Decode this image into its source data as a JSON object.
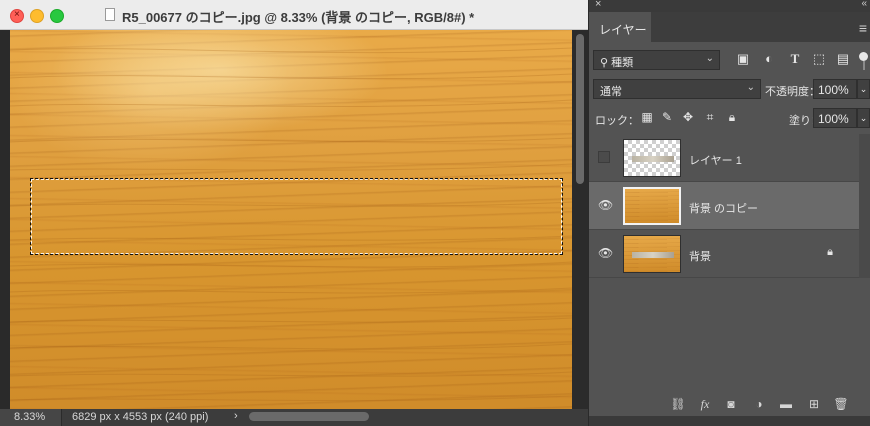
{
  "window": {
    "title": "R5_00677 のコピー.jpg @ 8.33% (背景 のコピー, RGB/8#) *"
  },
  "status_bar": {
    "zoom": "8.33%",
    "doc_size": "6829 px x 4553 px (240 ppi)",
    "arrow": "›"
  },
  "layers_panel": {
    "close_glyph": "×",
    "collapse_glyph": "«",
    "tab_label": "レイヤー",
    "menu_glyph": "≡",
    "filter_kind": "種類",
    "filter_icons": [
      "image-filter-icon",
      "adjustment-filter-icon",
      "type-filter-icon",
      "shape-filter-icon",
      "smart-object-filter-icon"
    ],
    "blend_mode": "通常",
    "opacity_label": "不透明度：",
    "opacity_value": "100%",
    "lock_label": "ロック：",
    "fill_label": "塗り：",
    "fill_value": "100%",
    "layers": [
      {
        "name": "レイヤー 1",
        "visible": false,
        "selected": false,
        "locked": false
      },
      {
        "name": "背景 のコピー",
        "visible": true,
        "selected": true,
        "locked": false
      },
      {
        "name": "背景",
        "visible": true,
        "selected": false,
        "locked": true
      }
    ],
    "footer_icons": [
      "link-icon",
      "fx-icon",
      "mask-icon",
      "adjustment-layer-icon",
      "folder-icon",
      "new-layer-icon",
      "trash-icon"
    ]
  },
  "colors": {
    "panel_bg": "#535353",
    "selected_row": "#6a6a6a",
    "wood_base": "#e0a040"
  }
}
